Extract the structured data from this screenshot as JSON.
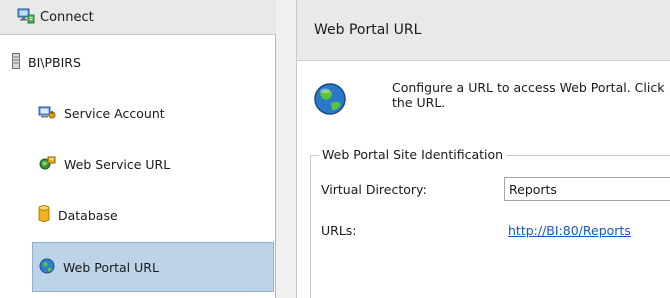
{
  "nav": {
    "connect_label": "Connect",
    "server_label": "BI\\PBIRS",
    "items": [
      {
        "label": "Service Account",
        "icon": "service-account-icon"
      },
      {
        "label": "Web Service URL",
        "icon": "web-service-icon"
      },
      {
        "label": "Database",
        "icon": "database-icon"
      },
      {
        "label": "Web Portal URL",
        "icon": "globe-icon",
        "selected": true
      }
    ]
  },
  "panel": {
    "title": "Web Portal URL",
    "description_line1": "Configure a URL to access Web Portal.  Click",
    "description_line2": "the URL.",
    "group_label": "Web Portal Site Identification",
    "virtual_directory_label": "Virtual Directory:",
    "virtual_directory_value": "Reports",
    "urls_label": "URLs:",
    "url_link": "http://BI:80/Reports"
  },
  "colors": {
    "selected_bg": "#bcd3e8",
    "header_bg": "#e9e9e9",
    "link": "#1a56c7"
  }
}
